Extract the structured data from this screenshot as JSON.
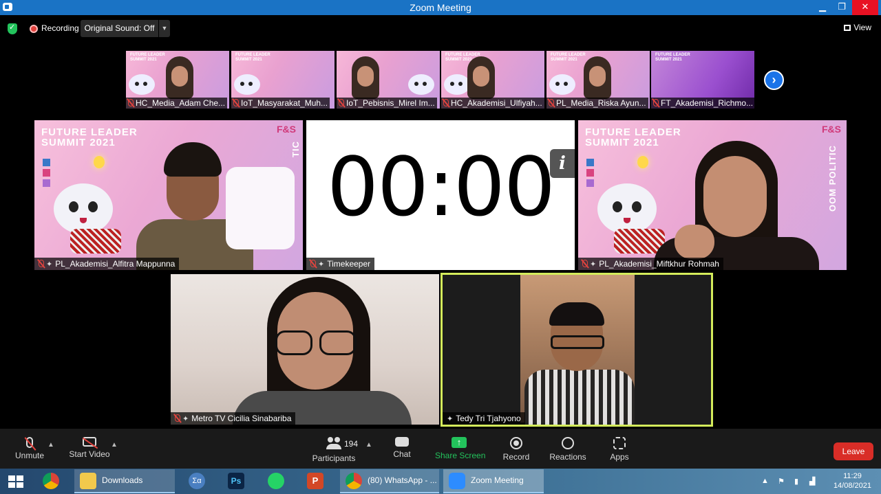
{
  "window": {
    "title": "Zoom Meeting",
    "min": "▁",
    "max": "❐",
    "close": "✕"
  },
  "status": {
    "recording_label": "Recording",
    "original_sound": "Original Sound: Off",
    "view_label": "View"
  },
  "strip": [
    {
      "name": "HC_Media_Adam Che..."
    },
    {
      "name": "IoT_Masyarakat_Muh..."
    },
    {
      "name": "IoT_Pebisnis_Mirel Im..."
    },
    {
      "name": "HC_Akademisi_Ulfiyah..."
    },
    {
      "name": "PL_Media_Riska Ayun..."
    },
    {
      "name": "FT_Akademisi_Richmo..."
    }
  ],
  "strip_brand": "FUTURE LEADER\nSUMMIT 2021",
  "tiles": {
    "alfitra": {
      "name": "PL_Akademisi_Alfitra Mappunna",
      "brand_line1": "FUTURE LEADER",
      "brand_line2": "SUMMIT 2021",
      "logo": "F&S",
      "side_text": "TIC"
    },
    "timekeeper": {
      "name": "Timekeeper",
      "timer": "00:00",
      "info": "i"
    },
    "miftkhur": {
      "name": "PL_Akademisi_Miftkhur Rohmah",
      "brand_line1": "FUTURE LEADER",
      "brand_line2": "SUMMIT 2021",
      "logo": "F&S",
      "side_text": "OOM POLITIC"
    },
    "cilicia": {
      "name": "Metro TV Cicilia Sinabariba"
    },
    "tedy": {
      "name": "Tedy Tri Tjahyono"
    }
  },
  "controls": {
    "unmute": "Unmute",
    "start_video": "Start Video",
    "participants": "Participants",
    "participant_count": "194",
    "chat": "Chat",
    "share_screen": "Share Screen",
    "record": "Record",
    "reactions": "Reactions",
    "apps": "Apps",
    "leave": "Leave"
  },
  "taskbar": {
    "downloads": "Downloads",
    "whatsapp": "(80) WhatsApp - ...",
    "zoom": "Zoom Meeting",
    "time": "11:29",
    "date": "14/08/2021"
  },
  "colors": {
    "titlebar": "#1a73c5",
    "active_speaker_border": "#d4ec5b",
    "share_green": "#23c35c",
    "leave_red": "#d92d27"
  }
}
